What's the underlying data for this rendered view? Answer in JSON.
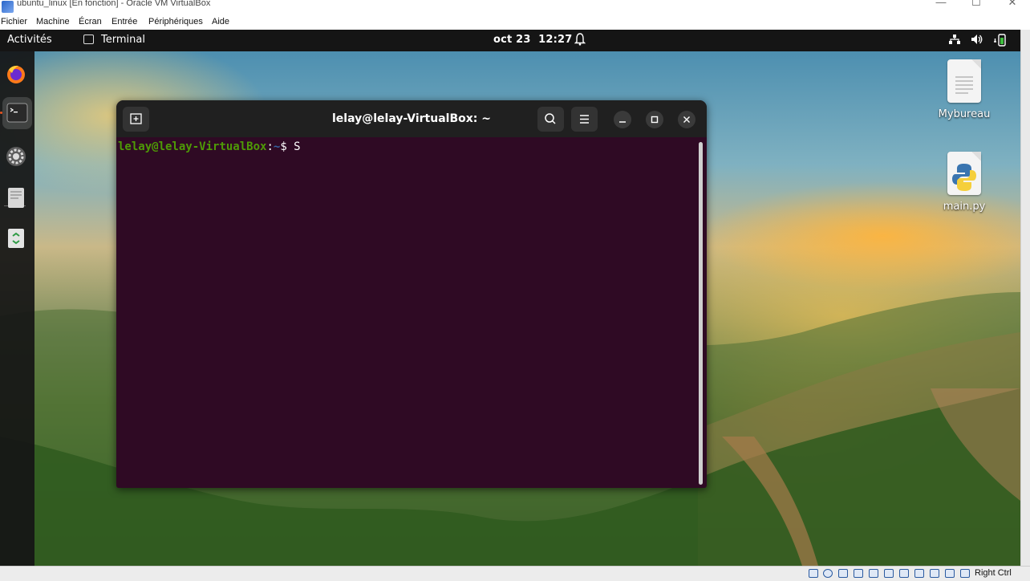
{
  "host_window": {
    "title": "ubuntu_linux [En fonction] - Oracle VM VirtualBox",
    "controls": {
      "minimize": "—",
      "maximize": "☐",
      "close": "✕"
    }
  },
  "host_menu": [
    "Fichier",
    "Machine",
    "Écran",
    "Entrée",
    "Périphériques",
    "Aide"
  ],
  "top_bar": {
    "activities": "Activités",
    "app_name": "Terminal",
    "date": "oct 23",
    "time": "12:27"
  },
  "dock": {
    "items": [
      {
        "name": "Firefox",
        "icon": "firefox-icon"
      },
      {
        "name": "Terminal",
        "icon": "terminal-icon",
        "active": true
      },
      {
        "name": "Settings",
        "icon": "settings-gear-icon"
      },
      {
        "name": "Text Editor",
        "icon": "text-editor-icon"
      },
      {
        "name": "Trash",
        "icon": "trash-icon"
      }
    ]
  },
  "desktop_icons": [
    {
      "label": "Mybureau",
      "icon": "text-file-icon"
    },
    {
      "label": "main.py",
      "icon": "python-file-icon"
    }
  ],
  "terminal": {
    "title": "lelay@lelay-VirtualBox: ~",
    "prompt_user": "lelay@lelay-VirtualBox",
    "prompt_sep": ":",
    "prompt_path": "~",
    "prompt_symbol": "$ ",
    "command": "S"
  },
  "status_bar": {
    "host_key": "Right Ctrl"
  },
  "colors": {
    "terminal_bg": "#2f0a24",
    "prompt_user": "#4e9a06",
    "prompt_path": "#3465a4",
    "topbar_bg": "#151515",
    "headerbar_bg": "#202020"
  }
}
